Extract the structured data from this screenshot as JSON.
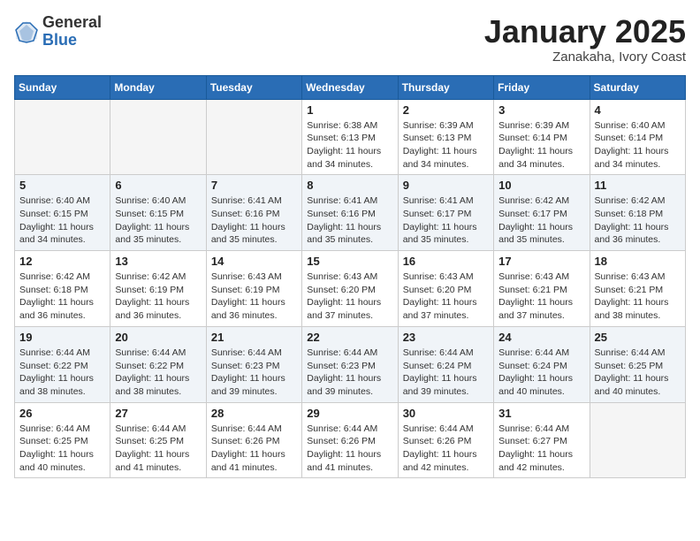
{
  "header": {
    "logo_general": "General",
    "logo_blue": "Blue",
    "month_title": "January 2025",
    "location": "Zanakaha, Ivory Coast"
  },
  "days_of_week": [
    "Sunday",
    "Monday",
    "Tuesday",
    "Wednesday",
    "Thursday",
    "Friday",
    "Saturday"
  ],
  "weeks": [
    [
      {
        "day": "",
        "info": ""
      },
      {
        "day": "",
        "info": ""
      },
      {
        "day": "",
        "info": ""
      },
      {
        "day": "1",
        "info": "Sunrise: 6:38 AM\nSunset: 6:13 PM\nDaylight: 11 hours\nand 34 minutes."
      },
      {
        "day": "2",
        "info": "Sunrise: 6:39 AM\nSunset: 6:13 PM\nDaylight: 11 hours\nand 34 minutes."
      },
      {
        "day": "3",
        "info": "Sunrise: 6:39 AM\nSunset: 6:14 PM\nDaylight: 11 hours\nand 34 minutes."
      },
      {
        "day": "4",
        "info": "Sunrise: 6:40 AM\nSunset: 6:14 PM\nDaylight: 11 hours\nand 34 minutes."
      }
    ],
    [
      {
        "day": "5",
        "info": "Sunrise: 6:40 AM\nSunset: 6:15 PM\nDaylight: 11 hours\nand 34 minutes."
      },
      {
        "day": "6",
        "info": "Sunrise: 6:40 AM\nSunset: 6:15 PM\nDaylight: 11 hours\nand 35 minutes."
      },
      {
        "day": "7",
        "info": "Sunrise: 6:41 AM\nSunset: 6:16 PM\nDaylight: 11 hours\nand 35 minutes."
      },
      {
        "day": "8",
        "info": "Sunrise: 6:41 AM\nSunset: 6:16 PM\nDaylight: 11 hours\nand 35 minutes."
      },
      {
        "day": "9",
        "info": "Sunrise: 6:41 AM\nSunset: 6:17 PM\nDaylight: 11 hours\nand 35 minutes."
      },
      {
        "day": "10",
        "info": "Sunrise: 6:42 AM\nSunset: 6:17 PM\nDaylight: 11 hours\nand 35 minutes."
      },
      {
        "day": "11",
        "info": "Sunrise: 6:42 AM\nSunset: 6:18 PM\nDaylight: 11 hours\nand 36 minutes."
      }
    ],
    [
      {
        "day": "12",
        "info": "Sunrise: 6:42 AM\nSunset: 6:18 PM\nDaylight: 11 hours\nand 36 minutes."
      },
      {
        "day": "13",
        "info": "Sunrise: 6:42 AM\nSunset: 6:19 PM\nDaylight: 11 hours\nand 36 minutes."
      },
      {
        "day": "14",
        "info": "Sunrise: 6:43 AM\nSunset: 6:19 PM\nDaylight: 11 hours\nand 36 minutes."
      },
      {
        "day": "15",
        "info": "Sunrise: 6:43 AM\nSunset: 6:20 PM\nDaylight: 11 hours\nand 37 minutes."
      },
      {
        "day": "16",
        "info": "Sunrise: 6:43 AM\nSunset: 6:20 PM\nDaylight: 11 hours\nand 37 minutes."
      },
      {
        "day": "17",
        "info": "Sunrise: 6:43 AM\nSunset: 6:21 PM\nDaylight: 11 hours\nand 37 minutes."
      },
      {
        "day": "18",
        "info": "Sunrise: 6:43 AM\nSunset: 6:21 PM\nDaylight: 11 hours\nand 38 minutes."
      }
    ],
    [
      {
        "day": "19",
        "info": "Sunrise: 6:44 AM\nSunset: 6:22 PM\nDaylight: 11 hours\nand 38 minutes."
      },
      {
        "day": "20",
        "info": "Sunrise: 6:44 AM\nSunset: 6:22 PM\nDaylight: 11 hours\nand 38 minutes."
      },
      {
        "day": "21",
        "info": "Sunrise: 6:44 AM\nSunset: 6:23 PM\nDaylight: 11 hours\nand 39 minutes."
      },
      {
        "day": "22",
        "info": "Sunrise: 6:44 AM\nSunset: 6:23 PM\nDaylight: 11 hours\nand 39 minutes."
      },
      {
        "day": "23",
        "info": "Sunrise: 6:44 AM\nSunset: 6:24 PM\nDaylight: 11 hours\nand 39 minutes."
      },
      {
        "day": "24",
        "info": "Sunrise: 6:44 AM\nSunset: 6:24 PM\nDaylight: 11 hours\nand 40 minutes."
      },
      {
        "day": "25",
        "info": "Sunrise: 6:44 AM\nSunset: 6:25 PM\nDaylight: 11 hours\nand 40 minutes."
      }
    ],
    [
      {
        "day": "26",
        "info": "Sunrise: 6:44 AM\nSunset: 6:25 PM\nDaylight: 11 hours\nand 40 minutes."
      },
      {
        "day": "27",
        "info": "Sunrise: 6:44 AM\nSunset: 6:25 PM\nDaylight: 11 hours\nand 41 minutes."
      },
      {
        "day": "28",
        "info": "Sunrise: 6:44 AM\nSunset: 6:26 PM\nDaylight: 11 hours\nand 41 minutes."
      },
      {
        "day": "29",
        "info": "Sunrise: 6:44 AM\nSunset: 6:26 PM\nDaylight: 11 hours\nand 41 minutes."
      },
      {
        "day": "30",
        "info": "Sunrise: 6:44 AM\nSunset: 6:26 PM\nDaylight: 11 hours\nand 42 minutes."
      },
      {
        "day": "31",
        "info": "Sunrise: 6:44 AM\nSunset: 6:27 PM\nDaylight: 11 hours\nand 42 minutes."
      },
      {
        "day": "",
        "info": ""
      }
    ]
  ]
}
